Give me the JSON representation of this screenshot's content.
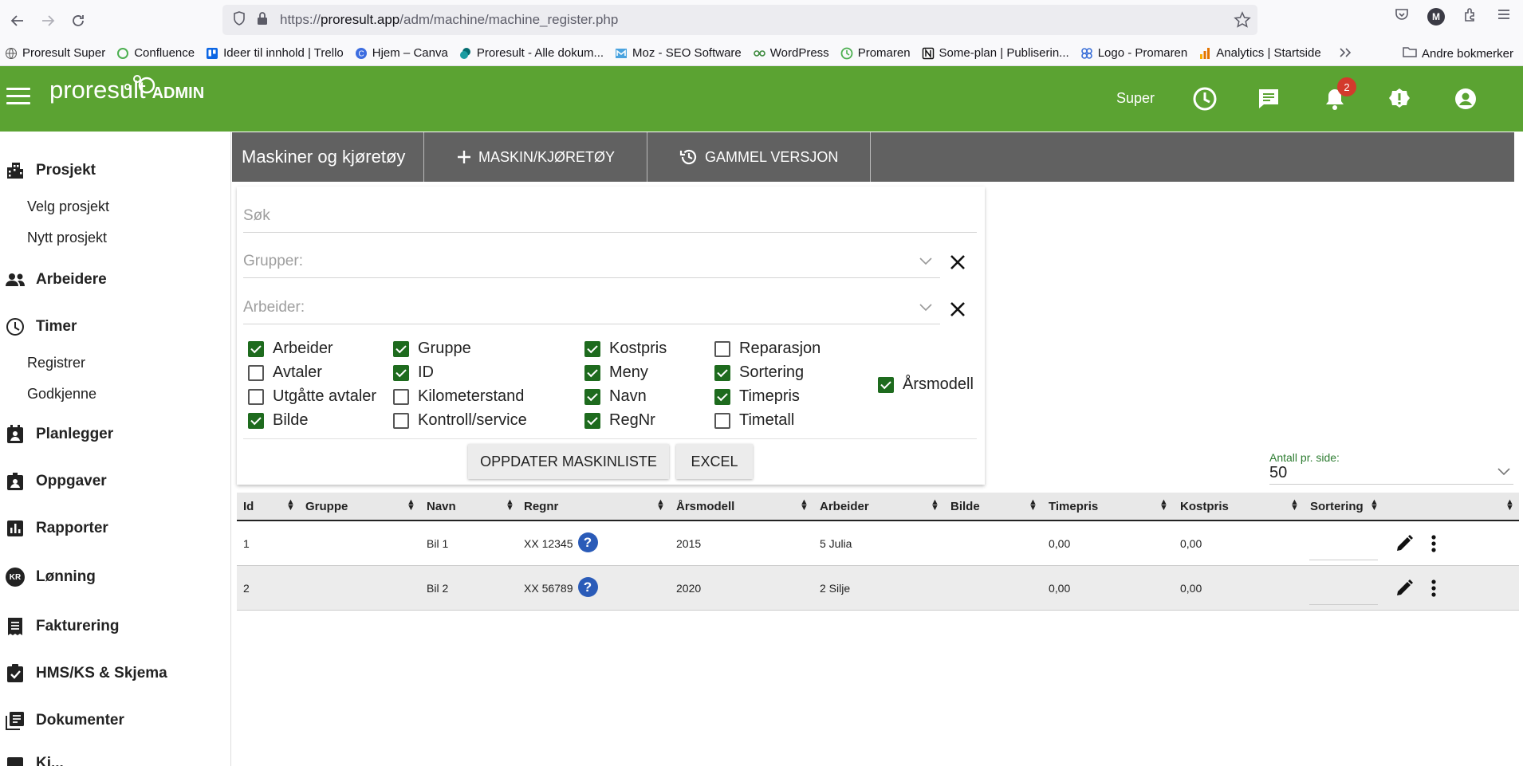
{
  "browser": {
    "url_prefix": "https://",
    "url_host": "proresult.app",
    "url_path": "/adm/machine/machine_register.php",
    "profile_initial": "M",
    "bookmarks": [
      {
        "label": "Proresult Super",
        "icon": "globe-icon"
      },
      {
        "label": "Confluence",
        "icon": "confluence-icon"
      },
      {
        "label": "Ideer til innhold | Trello",
        "icon": "trello-icon"
      },
      {
        "label": "Hjem – Canva",
        "icon": "canva-icon"
      },
      {
        "label": "Proresult - Alle dokum...",
        "icon": "sharepoint-icon"
      },
      {
        "label": "Moz - SEO Software",
        "icon": "moz-icon"
      },
      {
        "label": "WordPress",
        "icon": "wordpress-icon"
      },
      {
        "label": "Promaren",
        "icon": "promaren-icon"
      },
      {
        "label": "Some-plan | Publiserin...",
        "icon": "notion-icon"
      },
      {
        "label": "Logo - Promaren",
        "icon": "logo-icon"
      },
      {
        "label": "Analytics | Startside",
        "icon": "analytics-icon"
      }
    ],
    "other_bookmarks": "Andre bokmerker"
  },
  "header": {
    "logo_text": "proresult",
    "logo_admin": "ADMIN",
    "user_label": "Super",
    "notification_count": "2"
  },
  "sidebar": {
    "prosjekt": "Prosjekt",
    "velg_prosjekt": "Velg prosjekt",
    "nytt_prosjekt": "Nytt prosjekt",
    "arbeidere": "Arbeidere",
    "timer": "Timer",
    "registrer": "Registrer",
    "godkjenne": "Godkjenne",
    "planlegger": "Planlegger",
    "oppgaver": "Oppgaver",
    "rapporter": "Rapporter",
    "lonning": "Lønning",
    "kr": "KR",
    "fakturering": "Fakturering",
    "hms": "HMS/KS & Skjema",
    "dokumenter": "Dokumenter",
    "partial": "Ki..."
  },
  "toolbar": {
    "title": "Maskiner og kjøretøy",
    "add_label": "MASKIN/KJØRETØY",
    "old_label": "GAMMEL VERSJON"
  },
  "filters": {
    "search_placeholder": "Søk",
    "groups_placeholder": "Grupper:",
    "worker_placeholder": "Arbeider:",
    "columns": {
      "arbeider": {
        "label": "Arbeider",
        "checked": true
      },
      "avtaler": {
        "label": "Avtaler",
        "checked": false
      },
      "utgatte": {
        "label": "Utgåtte avtaler",
        "checked": false
      },
      "bilde": {
        "label": "Bilde",
        "checked": true
      },
      "gruppe": {
        "label": "Gruppe",
        "checked": true
      },
      "id": {
        "label": "ID",
        "checked": true
      },
      "km": {
        "label": "Kilometerstand",
        "checked": false
      },
      "kontroll": {
        "label": "Kontroll/service",
        "checked": false
      },
      "kostpris": {
        "label": "Kostpris",
        "checked": true
      },
      "meny": {
        "label": "Meny",
        "checked": true
      },
      "navn": {
        "label": "Navn",
        "checked": true
      },
      "regnr": {
        "label": "RegNr",
        "checked": true
      },
      "reparasjon": {
        "label": "Reparasjon",
        "checked": false
      },
      "sortering": {
        "label": "Sortering",
        "checked": true
      },
      "timepris": {
        "label": "Timepris",
        "checked": true
      },
      "timetall": {
        "label": "Timetall",
        "checked": false
      },
      "arsmodell": {
        "label": "Årsmodell",
        "checked": true
      }
    },
    "update_button": "OPPDATER MASKINLISTE",
    "excel_button": "EXCEL"
  },
  "perpage": {
    "label": "Antall pr. side:",
    "value": "50"
  },
  "table": {
    "headers": {
      "id": "Id",
      "gruppe": "Gruppe",
      "navn": "Navn",
      "regnr": "Regnr",
      "arsmodell": "Årsmodell",
      "arbeider": "Arbeider",
      "bilde": "Bilde",
      "timepris": "Timepris",
      "kostpris": "Kostpris",
      "sortering": "Sortering"
    },
    "rows": [
      {
        "id": "1",
        "gruppe": "",
        "navn": "Bil 1",
        "regnr": "XX 12345",
        "arsmodell": "2015",
        "arbeider": "5 Julia",
        "bilde": "",
        "timepris": "0,00",
        "kostpris": "0,00"
      },
      {
        "id": "2",
        "gruppe": "",
        "navn": "Bil 2",
        "regnr": "XX 56789",
        "arsmodell": "2020",
        "arbeider": "2 Silje",
        "bilde": "",
        "timepris": "0,00",
        "kostpris": "0,00"
      }
    ],
    "help_glyph": "?"
  },
  "colors": {
    "brand_green": "#5ba332",
    "toolbar_gray": "#616161",
    "check_green": "#1e6b1e",
    "badge_red": "#d33a2c",
    "help_blue": "#2a5bb8"
  }
}
